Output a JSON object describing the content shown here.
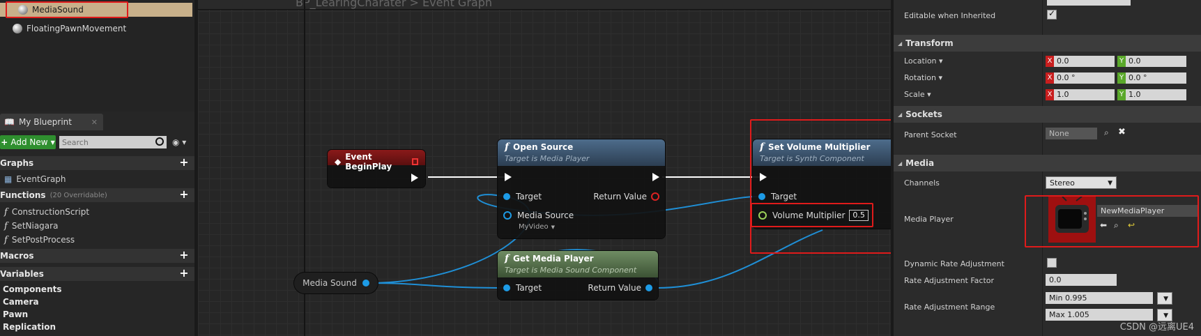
{
  "components": {
    "items": [
      {
        "label": "MediaSound",
        "selected": true,
        "icon": "sphere-icon"
      },
      {
        "label": "FloatingPawnMovement",
        "selected": false,
        "icon": "sphere-icon"
      }
    ]
  },
  "my_blueprint": {
    "tab_label": "My Blueprint",
    "add_new_label": "Add New",
    "search_placeholder": "Search",
    "graphs": {
      "label": "Graphs",
      "items": [
        "EventGraph"
      ]
    },
    "functions": {
      "label": "Functions",
      "sub": "(20 Overridable)",
      "items": [
        "ConstructionScript",
        "SetNiagara",
        "SetPostProcess"
      ]
    },
    "macros": {
      "label": "Macros"
    },
    "variables": {
      "label": "Variables",
      "categories": [
        "Components",
        "Camera",
        "Pawn",
        "Replication"
      ]
    }
  },
  "graph": {
    "breadcrumb": "BP_LearingCharater > Event Graph",
    "nodes": {
      "begin_play": {
        "title": "Event BeginPlay"
      },
      "open_source": {
        "title": "Open Source",
        "subtitle": "Target is Media Player",
        "pin_target": "Target",
        "pin_return": "Return Value",
        "pin_source": "Media Source",
        "source_value": "MyVideo"
      },
      "set_volume": {
        "title": "Set Volume Multiplier",
        "subtitle": "Target is Synth Component",
        "pin_target": "Target",
        "pin_volume": "Volume Multiplier",
        "volume_value": "0.5"
      },
      "get_media_player": {
        "title": "Get Media Player",
        "subtitle": "Target is Media Sound Component",
        "pin_target": "Target",
        "pin_return": "Return Value"
      },
      "media_sound": {
        "title": "Media Sound"
      }
    }
  },
  "details": {
    "editable_when_inherited": "Editable when Inherited",
    "transform": {
      "label": "Transform",
      "location": {
        "label": "Location",
        "x": "0.0",
        "y": "0.0"
      },
      "rotation": {
        "label": "Rotation",
        "x": "0.0 °",
        "y": "0.0 °"
      },
      "scale": {
        "label": "Scale",
        "x": "1.0",
        "y": "1.0"
      }
    },
    "sockets": {
      "label": "Sockets",
      "parent_socket": "Parent Socket",
      "parent_value": "None"
    },
    "media": {
      "label": "Media",
      "channels": "Channels",
      "channels_value": "Stereo",
      "media_player": "Media Player",
      "media_player_value": "NewMediaPlayer",
      "dynamic_rate": "Dynamic Rate Adjustment",
      "rate_factor": "Rate Adjustment Factor",
      "rate_factor_value": "0.0",
      "rate_range": "Rate Adjustment Range",
      "rate_min": "Min  0.995",
      "rate_max": "Max  1.005"
    }
  },
  "watermark": "CSDN @远离UE4"
}
